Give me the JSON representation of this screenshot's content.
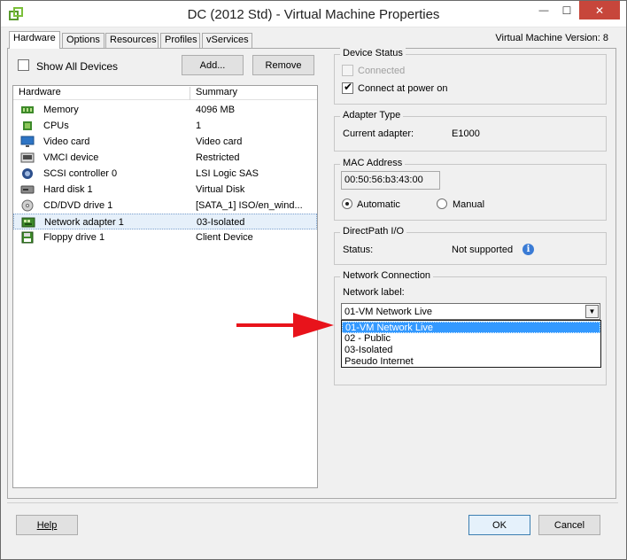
{
  "window": {
    "title": "DC (2012 Std) - Virtual Machine Properties",
    "minimize_glyph": "—",
    "maximize_glyph": "☐",
    "close_glyph": "✕"
  },
  "tabs": [
    "Hardware",
    "Options",
    "Resources",
    "Profiles",
    "vServices"
  ],
  "active_tab": "Hardware",
  "version_label": "Virtual Machine Version: 8",
  "toolbar": {
    "show_all_devices_label": "Show All Devices",
    "show_all_devices_checked": false,
    "add_label": "Add...",
    "remove_label": "Remove"
  },
  "device_table": {
    "headers": [
      "Hardware",
      "Summary"
    ],
    "rows": [
      {
        "name": "Memory",
        "summary": "4096 MB",
        "icon": "memory-icon"
      },
      {
        "name": "CPUs",
        "summary": "1",
        "icon": "cpu-icon"
      },
      {
        "name": "Video card",
        "summary": "Video card",
        "icon": "monitor-icon"
      },
      {
        "name": "VMCI device",
        "summary": "Restricted",
        "icon": "vmci-icon"
      },
      {
        "name": "SCSI controller 0",
        "summary": "LSI Logic SAS",
        "icon": "scsi-icon"
      },
      {
        "name": "Hard disk 1",
        "summary": "Virtual Disk",
        "icon": "hard-disk-icon"
      },
      {
        "name": "CD/DVD drive 1",
        "summary": "[SATA_1] ISO/en_wind...",
        "icon": "cd-dvd-icon"
      },
      {
        "name": "Network adapter 1",
        "summary": "03-Isolated",
        "icon": "network-adapter-icon"
      },
      {
        "name": "Floppy drive 1",
        "summary": "Client Device",
        "icon": "floppy-icon"
      }
    ],
    "selected_row": "Network adapter 1"
  },
  "device_status": {
    "legend": "Device Status",
    "connected_label": "Connected",
    "connected_checked": false,
    "connect_at_power_on_label": "Connect at power on",
    "connect_at_power_on_checked": true
  },
  "adapter_type": {
    "legend": "Adapter Type",
    "current_adapter_label": "Current adapter:",
    "current_adapter_value": "E1000"
  },
  "mac_address": {
    "legend": "MAC Address",
    "value": "00:50:56:b3:43:00",
    "automatic_label": "Automatic",
    "manual_label": "Manual",
    "selected": "Automatic"
  },
  "directpath": {
    "legend": "DirectPath I/O",
    "status_label": "Status:",
    "status_value": "Not supported",
    "info_glyph": "i"
  },
  "network_connection": {
    "legend": "Network Connection",
    "network_label_caption": "Network label:",
    "selected_value": "01-VM Network Live",
    "options": [
      "01-VM Network Live",
      "02 - Public",
      "03-Isolated",
      "Pseudo Internet"
    ],
    "highlighted_option": "01-VM Network Live",
    "arrow_glyph": "▼"
  },
  "footer": {
    "help_label": "Help",
    "ok_label": "OK",
    "cancel_label": "Cancel"
  },
  "colors": {
    "annotation_arrow": "#e8131b",
    "selection_highlight": "#3399ff",
    "close_button": "#c7463b"
  }
}
